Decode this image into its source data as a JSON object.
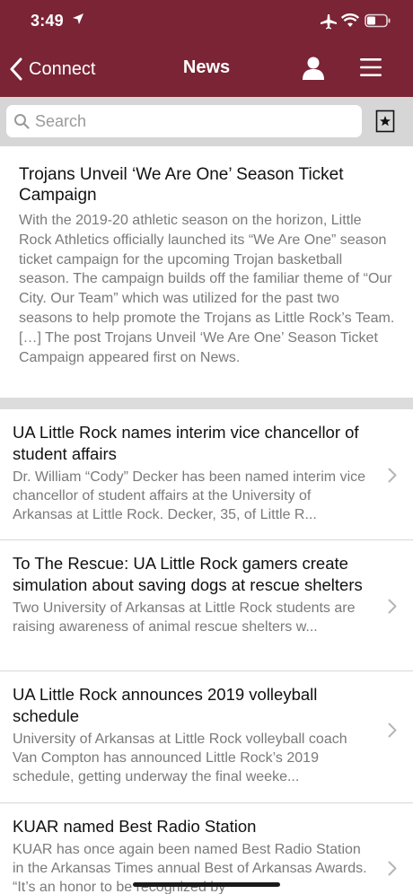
{
  "status_bar": {
    "time": "3:49"
  },
  "nav": {
    "back_label": "Connect",
    "title": "News"
  },
  "search": {
    "placeholder": "Search"
  },
  "featured": {
    "title": "Trojans Unveil ‘We Are One’ Season Ticket Campaign",
    "body": "With the 2019-20 athletic season on the horizon, Little Rock Athletics officially launched its “We Are One” season ticket campaign for the upcoming Trojan basketball season. The campaign builds off the familiar theme of “Our City. Our Team” which was utilized for the past two seasons to help promote the Trojans as Little Rock’s Team. […] The post Trojans Unveil ‘We Are One’ Season Ticket Campaign appeared first on News."
  },
  "articles": [
    {
      "title": "UA Little Rock names interim vice chancellor of student affairs",
      "summary": "Dr. William “Cody” Decker has been named interim vice chancellor of student affairs at the University of Arkansas at Little Rock.  Decker, 35, of Little R..."
    },
    {
      "title": "To The Rescue: UA Little Rock gamers create simulation about saving dogs at rescue shelters",
      "summary": "Two University of Arkansas at Little Rock students are raising awareness of animal rescue shelters w..."
    },
    {
      "title": "UA Little Rock announces 2019 volleyball schedule",
      "summary": "University of Arkansas at Little Rock volleyball coach Van Compton has announced Little Rock’s 2019 schedule, getting underway the final weeke..."
    },
    {
      "title": "KUAR named Best Radio Station",
      "summary": "KUAR has once again been named Best Radio Station in the Arkansas Times annual Best of Arkansas Awards. “It’s an honor to be recognized by"
    }
  ],
  "colors": {
    "header": "#7a2435",
    "search_bar": "#d6d6d6",
    "muted_text": "#7a7a7a"
  }
}
